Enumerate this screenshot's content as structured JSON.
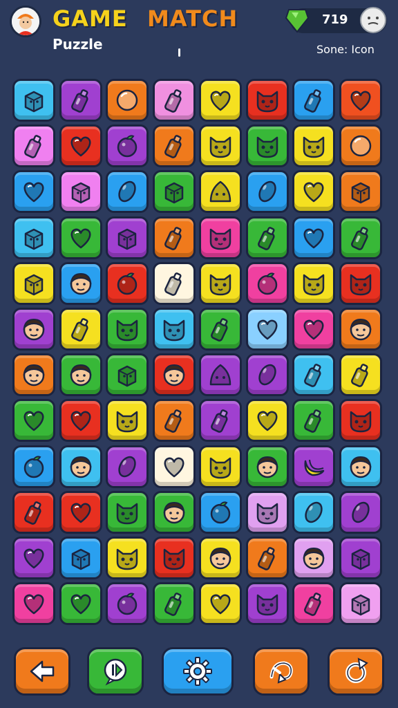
{
  "header": {
    "title_part1": "GAME",
    "title_part2": "MATCH",
    "subtitle": "Puzzle",
    "score_value": "719",
    "score_label": "Sone: Icon",
    "colors": {
      "title1": "#f5d21c",
      "title2": "#f08a1c",
      "gem": "#58c234"
    }
  },
  "board": {
    "rows": 12,
    "cols": 8,
    "tiles": [
      [
        [
          "#3fc0f0",
          "box"
        ],
        [
          "#a040d0",
          "bottle"
        ],
        [
          "#f07a1c",
          "ball"
        ],
        [
          "#f090e0",
          "bottle"
        ],
        [
          "#f5e020",
          "heart"
        ],
        [
          "#e83020",
          "cat"
        ],
        [
          "#2aa0f0",
          "bottle"
        ],
        [
          "#f05020",
          "heart"
        ]
      ],
      [
        [
          "#f080f0",
          "bottle"
        ],
        [
          "#e83020",
          "heart"
        ],
        [
          "#a040d0",
          "orange"
        ],
        [
          "#f07a1c",
          "bottle"
        ],
        [
          "#f5e020",
          "cat"
        ],
        [
          "#38b838",
          "cat"
        ],
        [
          "#f5e020",
          "cat"
        ],
        [
          "#f07a1c",
          "ball"
        ]
      ],
      [
        [
          "#2aa0f0",
          "heart"
        ],
        [
          "#f080f0",
          "box"
        ],
        [
          "#2aa0f0",
          "bean"
        ],
        [
          "#38b838",
          "box"
        ],
        [
          "#f5e020",
          "blob"
        ],
        [
          "#2aa0f0",
          "bean"
        ],
        [
          "#f5e020",
          "heart"
        ],
        [
          "#f07a1c",
          "box"
        ]
      ],
      [
        [
          "#3fc0f0",
          "box"
        ],
        [
          "#38b838",
          "heart"
        ],
        [
          "#a040d0",
          "box"
        ],
        [
          "#f07a1c",
          "bottle"
        ],
        [
          "#f040a0",
          "cat"
        ],
        [
          "#38b838",
          "bottle"
        ],
        [
          "#2aa0f0",
          "heart"
        ],
        [
          "#38b838",
          "bottle"
        ]
      ],
      [
        [
          "#f5e020",
          "box"
        ],
        [
          "#2aa0f0",
          "face"
        ],
        [
          "#e83020",
          "orange"
        ],
        [
          "#fff6e0",
          "bottle"
        ],
        [
          "#f5e020",
          "cat"
        ],
        [
          "#f040a0",
          "orange"
        ],
        [
          "#f5e020",
          "cat"
        ],
        [
          "#e83020",
          "cat"
        ]
      ],
      [
        [
          "#a040d0",
          "face"
        ],
        [
          "#f5e020",
          "bottle"
        ],
        [
          "#38b838",
          "cat"
        ],
        [
          "#3fc0f0",
          "cat"
        ],
        [
          "#38b838",
          "bottle"
        ],
        [
          "#8ad0ff",
          "heart"
        ],
        [
          "#f040a0",
          "heart"
        ],
        [
          "#f07a1c",
          "face"
        ]
      ],
      [
        [
          "#f07a1c",
          "face"
        ],
        [
          "#38b838",
          "face"
        ],
        [
          "#38b838",
          "box"
        ],
        [
          "#e83020",
          "face"
        ],
        [
          "#a040d0",
          "blob"
        ],
        [
          "#a040d0",
          "bean"
        ],
        [
          "#3fc0f0",
          "bottle"
        ],
        [
          "#f5e020",
          "bottle"
        ]
      ],
      [
        [
          "#38b838",
          "heart"
        ],
        [
          "#e83020",
          "heart"
        ],
        [
          "#f5e020",
          "cat"
        ],
        [
          "#f07a1c",
          "bottle"
        ],
        [
          "#a040d0",
          "bottle"
        ],
        [
          "#f5e020",
          "heart"
        ],
        [
          "#38b838",
          "bottle"
        ],
        [
          "#e83020",
          "cat"
        ]
      ],
      [
        [
          "#2aa0f0",
          "orange"
        ],
        [
          "#3fc0f0",
          "face"
        ],
        [
          "#a040d0",
          "bean"
        ],
        [
          "#fff6e0",
          "heart"
        ],
        [
          "#f5e020",
          "cat"
        ],
        [
          "#38b838",
          "face"
        ],
        [
          "#a040d0",
          "banana"
        ],
        [
          "#3fc0f0",
          "face"
        ]
      ],
      [
        [
          "#e83020",
          "bottle"
        ],
        [
          "#e83020",
          "heart"
        ],
        [
          "#38b838",
          "cat"
        ],
        [
          "#38b838",
          "face"
        ],
        [
          "#2aa0f0",
          "orange"
        ],
        [
          "#e0a0f0",
          "cat"
        ],
        [
          "#3fc0f0",
          "bean"
        ],
        [
          "#a040d0",
          "bean"
        ]
      ],
      [
        [
          "#a040d0",
          "heart"
        ],
        [
          "#2aa0f0",
          "box"
        ],
        [
          "#f5e020",
          "cat"
        ],
        [
          "#e83020",
          "cat"
        ],
        [
          "#f5e020",
          "face"
        ],
        [
          "#f07a1c",
          "bottle"
        ],
        [
          "#e0a0f0",
          "face"
        ],
        [
          "#a040d0",
          "box"
        ]
      ],
      [
        [
          "#f040a0",
          "heart"
        ],
        [
          "#38b838",
          "heart"
        ],
        [
          "#a040d0",
          "orange"
        ],
        [
          "#38b838",
          "bottle"
        ],
        [
          "#f5e020",
          "heart"
        ],
        [
          "#a040d0",
          "cat"
        ],
        [
          "#f040a0",
          "bottle"
        ],
        [
          "#f0a0f0",
          "box"
        ]
      ]
    ]
  },
  "bottom_bar": {
    "buttons": [
      {
        "name": "back-button",
        "icon": "back-arrow-icon",
        "color": "#f07a1c"
      },
      {
        "name": "hint-button",
        "icon": "hint-icon",
        "color": "#38b838"
      },
      {
        "name": "settings-button",
        "icon": "gear-icon",
        "color": "#2aa0f0"
      },
      {
        "name": "shuffle-button",
        "icon": "shuffle-icon",
        "color": "#f07a1c"
      },
      {
        "name": "restart-button",
        "icon": "restart-icon",
        "color": "#f07a1c"
      }
    ]
  }
}
